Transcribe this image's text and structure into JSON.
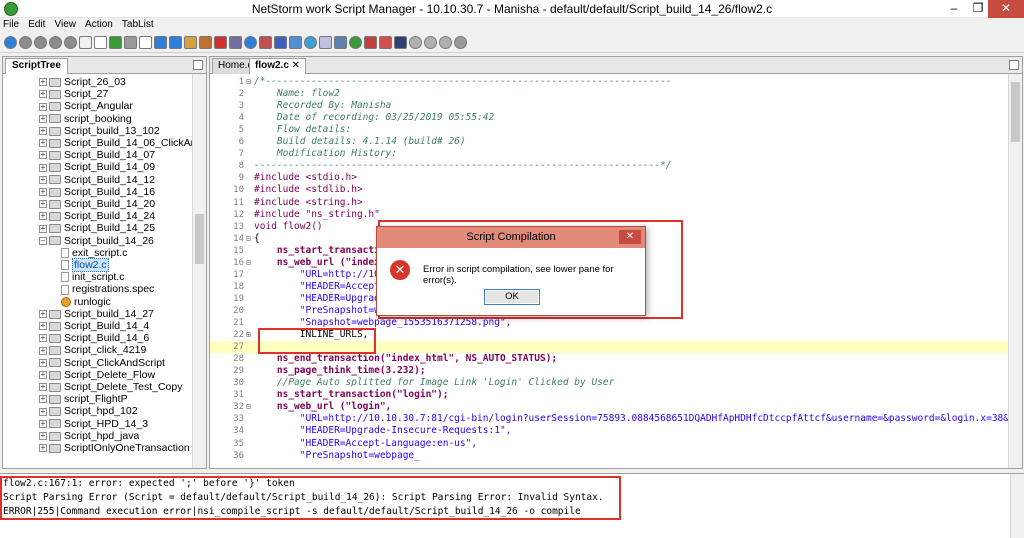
{
  "window": {
    "title": "NetStorm work Script Manager - 10.10.30.7 - Manisha - default/default/Script_build_14_26/flow2.c",
    "minimize": "–",
    "maximize": "❐",
    "close": "✕"
  },
  "menu": [
    "File",
    "Edit",
    "View",
    "Action",
    "TabList"
  ],
  "left_pane": {
    "tab": "ScriptTree",
    "items": [
      {
        "label": "Script_26_03",
        "type": "folder",
        "level": 0,
        "expander": "+"
      },
      {
        "label": "Script_27",
        "type": "folder",
        "level": 0,
        "expander": "+"
      },
      {
        "label": "Script_Angular",
        "type": "folder",
        "level": 0,
        "expander": "+"
      },
      {
        "label": "script_booking",
        "type": "folder",
        "level": 0,
        "expander": "+"
      },
      {
        "label": "Script_build_13_102",
        "type": "folder",
        "level": 0,
        "expander": "+"
      },
      {
        "label": "Script_Build_14_06_ClickAn",
        "type": "folder",
        "level": 0,
        "expander": "+"
      },
      {
        "label": "Script_Build_14_07",
        "type": "folder",
        "level": 0,
        "expander": "+"
      },
      {
        "label": "Script_Build_14_09",
        "type": "folder",
        "level": 0,
        "expander": "+"
      },
      {
        "label": "Script_Build_14_12",
        "type": "folder",
        "level": 0,
        "expander": "+"
      },
      {
        "label": "Script_Build_14_16",
        "type": "folder",
        "level": 0,
        "expander": "+"
      },
      {
        "label": "Script_Build_14_20",
        "type": "folder",
        "level": 0,
        "expander": "+"
      },
      {
        "label": "Script_Build_14_24",
        "type": "folder",
        "level": 0,
        "expander": "+"
      },
      {
        "label": "Script_Build_14_25",
        "type": "folder",
        "level": 0,
        "expander": "+"
      },
      {
        "label": "Script_build_14_26",
        "type": "folder",
        "level": 0,
        "expander": "–"
      },
      {
        "label": "exit_script.c",
        "type": "file",
        "level": 1,
        "expander": ""
      },
      {
        "label": "flow2.c",
        "type": "file",
        "level": 1,
        "expander": "",
        "selected": true
      },
      {
        "label": "init_script.c",
        "type": "file",
        "level": 1,
        "expander": ""
      },
      {
        "label": "registrations.spec",
        "type": "file",
        "level": 1,
        "expander": ""
      },
      {
        "label": "runlogic",
        "type": "gear",
        "level": 1,
        "expander": ""
      },
      {
        "label": "Script_build_14_27",
        "type": "folder",
        "level": 0,
        "expander": "+"
      },
      {
        "label": "Script_Build_14_4",
        "type": "folder",
        "level": 0,
        "expander": "+"
      },
      {
        "label": "Script_Build_14_6",
        "type": "folder",
        "level": 0,
        "expander": "+"
      },
      {
        "label": "Script_click_4219",
        "type": "folder",
        "level": 0,
        "expander": "+"
      },
      {
        "label": "Script_ClickAndScript",
        "type": "folder",
        "level": 0,
        "expander": "+"
      },
      {
        "label": "Script_Delete_Flow",
        "type": "folder",
        "level": 0,
        "expander": "+"
      },
      {
        "label": "Script_Delete_Test_Copy",
        "type": "folder",
        "level": 0,
        "expander": "+"
      },
      {
        "label": "script_FlightP",
        "type": "folder",
        "level": 0,
        "expander": "+"
      },
      {
        "label": "Script_hpd_102",
        "type": "folder",
        "level": 0,
        "expander": "+"
      },
      {
        "label": "Script_HPD_14_3",
        "type": "folder",
        "level": 0,
        "expander": "+"
      },
      {
        "label": "Script_hpd_java",
        "type": "folder",
        "level": 0,
        "expander": "+"
      },
      {
        "label": "ScriptIOnlyOneTransaction",
        "type": "folder",
        "level": 0,
        "expander": "+"
      }
    ]
  },
  "editor": {
    "tabs": [
      {
        "label": "Home.c",
        "active": false
      },
      {
        "label": "flow2.c  ✕",
        "active": true
      }
    ],
    "lines": [
      {
        "n": "1",
        "fold": "⊟",
        "text": "/*-----------------------------------------------------------------------",
        "style": "comment"
      },
      {
        "n": "2",
        "fold": "",
        "text": "    Name: flow2",
        "style": "comment"
      },
      {
        "n": "3",
        "fold": "",
        "text": "    Recorded By: Manisha",
        "style": "comment"
      },
      {
        "n": "4",
        "fold": "",
        "text": "    Date of recording: 03/25/2019 05:55:42",
        "style": "comment"
      },
      {
        "n": "5",
        "fold": "",
        "text": "    Flow details:",
        "style": "comment"
      },
      {
        "n": "6",
        "fold": "",
        "text": "    Build details: 4.1.14 (build# 26)",
        "style": "comment"
      },
      {
        "n": "7",
        "fold": "",
        "text": "    Modification History:",
        "style": "comment"
      },
      {
        "n": "8",
        "fold": "",
        "text": "-----------------------------------------------------------------------*/",
        "style": "comment"
      },
      {
        "n": "9",
        "fold": "",
        "text": "#include <stdio.h>",
        "style": "kw"
      },
      {
        "n": "10",
        "fold": "",
        "text": "#include <stdlib.h>",
        "style": "kw"
      },
      {
        "n": "11",
        "fold": "",
        "text": "#include <string.h>",
        "style": "kw"
      },
      {
        "n": "12",
        "fold": "",
        "text": "#include \"ns_string.h\"",
        "style": "kw"
      },
      {
        "n": "13",
        "fold": "",
        "text": "void flow2()",
        "style": "kw"
      },
      {
        "n": "14",
        "fold": "⊟",
        "text": "{",
        "style": "plain"
      },
      {
        "n": "15",
        "fold": "",
        "text": "    ns_start_transaction",
        "style": "fn"
      },
      {
        "n": "16",
        "fold": "⊟",
        "text": "    ns_web_url (\"index_",
        "style": "fn"
      },
      {
        "n": "17",
        "fold": "",
        "text": "        \"URL=http://10.10",
        "style": "str"
      },
      {
        "n": "18",
        "fold": "",
        "text": "        \"HEADER=Accept-",
        "style": "str"
      },
      {
        "n": "19",
        "fold": "",
        "text": "        \"HEADER=Upgrade",
        "style": "str"
      },
      {
        "n": "20",
        "fold": "",
        "text": "        \"PreSnapshot=we",
        "style": "str"
      },
      {
        "n": "21",
        "fold": "",
        "text": "        \"Snapshot=webpage_1553516371258.png\",",
        "style": "str"
      },
      {
        "n": "22",
        "fold": "⊞",
        "text": "        INLINE_URLS,",
        "style": "plain"
      },
      {
        "n": "27",
        "fold": "",
        "text": "",
        "style": "plain",
        "current": true
      },
      {
        "n": "28",
        "fold": "",
        "text": "    ns_end_transaction(\"index_html\", NS_AUTO_STATUS);",
        "style": "fn"
      },
      {
        "n": "29",
        "fold": "",
        "text": "    ns_page_think_time(3.232);",
        "style": "fn"
      },
      {
        "n": "30",
        "fold": "",
        "text": "    //Page Auto splitted for Image Link 'Login' Clicked by User",
        "style": "comment"
      },
      {
        "n": "31",
        "fold": "",
        "text": "    ns_start_transaction(\"login\");",
        "style": "fn"
      },
      {
        "n": "32",
        "fold": "⊟",
        "text": "    ns_web_url (\"login\",",
        "style": "fn"
      },
      {
        "n": "33",
        "fold": "",
        "text": "        \"URL=http://10.10.30.7:81/cgi-bin/login?userSession=75893.0884568651DQADHfApHDHfcDtccpfAttcf&username=&password=&login.x=38&login.y=9&lo",
        "style": "str"
      },
      {
        "n": "34",
        "fold": "",
        "text": "        \"HEADER=Upgrade-Insecure-Requests:1\",",
        "style": "str"
      },
      {
        "n": "35",
        "fold": "",
        "text": "        \"HEADER=Accept-Language:en-us\",",
        "style": "str"
      },
      {
        "n": "36",
        "fold": "",
        "text": "        \"PreSnapshot=webpage_",
        "style": "str"
      }
    ]
  },
  "dialog": {
    "title": "Script Compilation",
    "close": "✕",
    "icon": "✕",
    "message": "Error in script compilation, see lower pane for error(s).",
    "ok": "OK"
  },
  "output": {
    "lines": [
      "flow2.c:167:1: error: expected ';' before '}' token",
      "Script Parsing Error (Script = default/default/Script_build_14_26): Script Parsing Error: Invalid Syntax.",
      "ERROR|255|Command execution error|nsi_compile_script -s default/default/Script_build_14_26 -o compile"
    ]
  },
  "toolbar_icons": [
    {
      "name": "run-icon",
      "color": "#2f7fd6"
    },
    {
      "name": "stop-icon",
      "color": "#8c8c8c"
    },
    {
      "name": "record-icon",
      "color": "#8c8c8c"
    },
    {
      "name": "pause-icon",
      "color": "#8c8c8c"
    },
    {
      "name": "resume-icon",
      "color": "#8c8c8c"
    },
    {
      "name": "comment-icon",
      "color": "#f0f0f0"
    },
    {
      "name": "new-file-icon",
      "color": "#ffffff"
    },
    {
      "name": "add-page-icon",
      "color": "#3a9a3a"
    },
    {
      "name": "copy-icon",
      "color": "#9a9a9a"
    },
    {
      "name": "document-icon",
      "color": "#ffffff"
    },
    {
      "name": "download-icon",
      "color": "#2f7fd6"
    },
    {
      "name": "upload-icon",
      "color": "#2f7fd6"
    },
    {
      "name": "settings-icon",
      "color": "#d4a040"
    },
    {
      "name": "export-icon",
      "color": "#c07030"
    },
    {
      "name": "delete-icon",
      "color": "#d03030"
    },
    {
      "name": "view-icon",
      "color": "#7070a0"
    },
    {
      "name": "target-icon",
      "color": "#2f7fd6"
    },
    {
      "name": "edit-icon",
      "color": "#c05050"
    },
    {
      "name": "check-icon",
      "color": "#4060c0"
    },
    {
      "name": "save-icon",
      "color": "#5090d0"
    },
    {
      "name": "globe-icon",
      "color": "#40a0d0"
    },
    {
      "name": "notes-icon",
      "color": "#c0c0e0"
    },
    {
      "name": "window-icon",
      "color": "#6080b0"
    },
    {
      "name": "play-icon",
      "color": "#3a9a3a"
    },
    {
      "name": "report-icon",
      "color": "#c04040"
    },
    {
      "name": "chart-icon",
      "color": "#d05050"
    },
    {
      "name": "disk-icon",
      "color": "#304070"
    },
    {
      "name": "undo-icon",
      "color": "#b0b0b0"
    },
    {
      "name": "redo-icon",
      "color": "#b0b0b0"
    },
    {
      "name": "refresh-icon",
      "color": "#b0b0b0"
    },
    {
      "name": "info-icon",
      "color": "#9a9a9a"
    }
  ]
}
